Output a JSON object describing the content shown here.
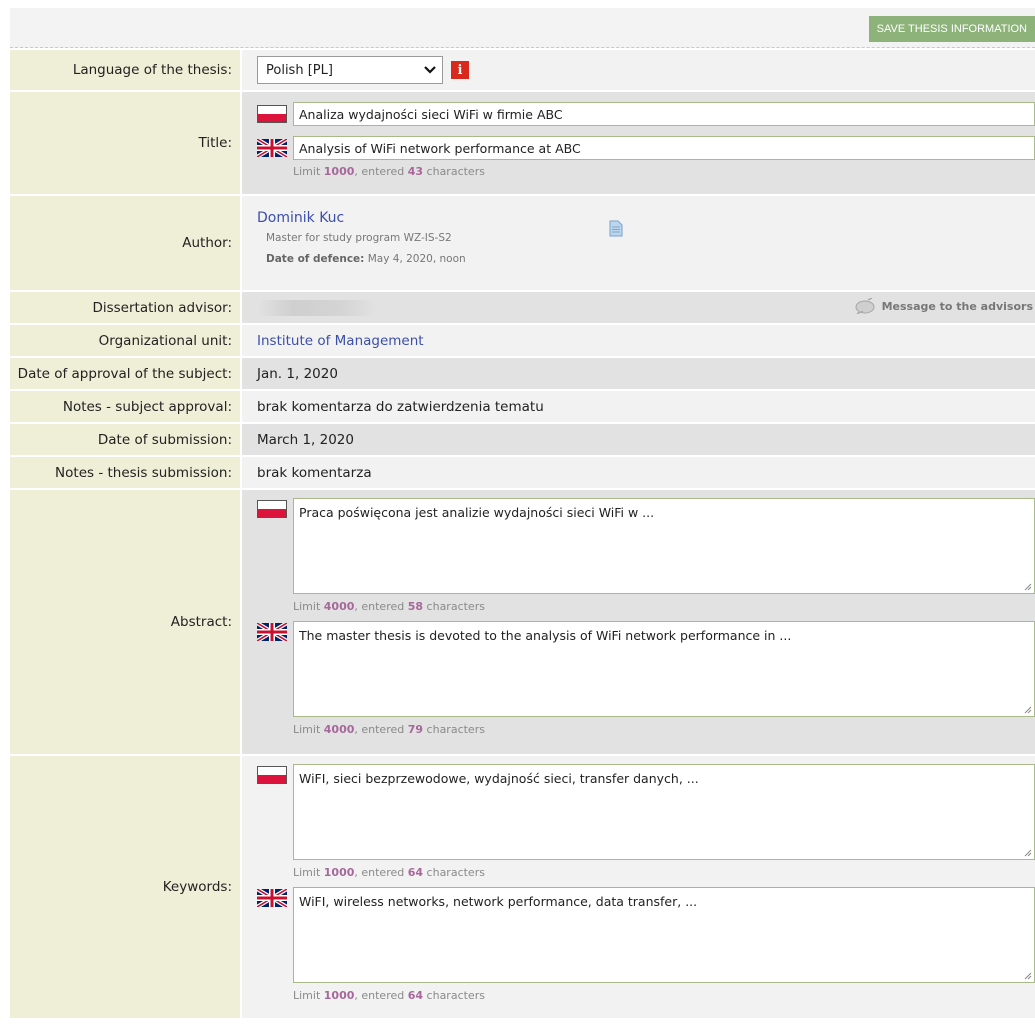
{
  "toolbar": {
    "save_label": "SAVE THESIS INFORMATION"
  },
  "language": {
    "label": "Language of the thesis:",
    "selected": "Polish [PL]",
    "info_icon": "info-icon"
  },
  "title": {
    "label": "Title:",
    "pl_value": "Analiza wydajności sieci WiFi w firmie ABC",
    "en_value": "Analysis of WiFi network performance at ABC",
    "limit_prefix": "Limit ",
    "limit": "1000",
    "limit_mid": ", entered ",
    "entered": "43",
    "limit_suffix": " characters"
  },
  "author": {
    "label": "Author:",
    "name": "Dominik Kuc",
    "program": "Master for study program WZ-IS-S2",
    "defence_label": "Date of defence:",
    "defence_value": " May 4, 2020, noon"
  },
  "advisor": {
    "label": "Dissertation advisor:",
    "message_label": "Message to the advisors"
  },
  "unit": {
    "label": "Organizational unit:",
    "value": "Institute of Management"
  },
  "approval_date": {
    "label": "Date of approval of the subject:",
    "value": "Jan. 1, 2020"
  },
  "approval_notes": {
    "label": "Notes - subject approval:",
    "value": "brak komentarza do zatwierdzenia tematu"
  },
  "submission_date": {
    "label": "Date of submission:",
    "value": "March 1, 2020"
  },
  "submission_notes": {
    "label": "Notes - thesis submission:",
    "value": "brak komentarza"
  },
  "abstract": {
    "label": "Abstract:",
    "pl_value": "Praca poświęcona jest analizie wydajności sieci WiFi w ...",
    "pl_limit": "4000",
    "pl_entered": "58",
    "en_value": "The master thesis is devoted to the analysis of WiFi network performance in ...",
    "en_limit": "4000",
    "en_entered": "79"
  },
  "keywords": {
    "label": "Keywords:",
    "pl_value": "WiFI, sieci bezprzewodowe, wydajność sieci, transfer danych, ...",
    "pl_limit": "1000",
    "pl_entered": "64",
    "en_value": "WiFI, wireless networks, network performance, data transfer, ...",
    "en_limit": "1000",
    "en_entered": "64"
  },
  "common": {
    "limit_prefix": "Limit ",
    "limit_mid": ", entered ",
    "limit_suffix": " characters"
  }
}
